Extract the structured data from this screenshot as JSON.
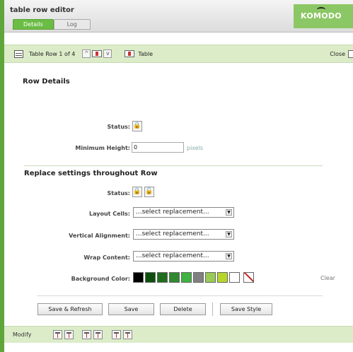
{
  "header": {
    "title": "table row editor",
    "tabs": [
      {
        "label": "Details"
      },
      {
        "label": "Log"
      }
    ],
    "brand": "KOMODO CMS"
  },
  "toolbar": {
    "row_label": "Table Row 1 of 4",
    "table_label": "Table",
    "close_label": "Close"
  },
  "row_details": {
    "title": "Row Details",
    "status_label": "Status:",
    "min_height_label": "Minimum Height:",
    "min_height_value": "0",
    "min_height_unit": "pixels"
  },
  "replace": {
    "title": "Replace settings throughout Row",
    "status_label": "Status:",
    "layout_cells_label": "Layout Cells:",
    "vertical_alignment_label": "Vertical Alignment:",
    "wrap_content_label": "Wrap Content:",
    "select_placeholder": "...select replacement...",
    "background_color_label": "Background Color:",
    "clear_label": "Clear",
    "swatches": [
      "#000000",
      "#0d4f0d",
      "#1f6e1f",
      "#2f8a2f",
      "#3fb33f",
      "#808080",
      "#99cc55",
      "#b7d62a",
      "#ffffff"
    ]
  },
  "actions": {
    "save_refresh": "Save & Refresh",
    "save": "Save",
    "delete": "Delete",
    "save_style": "Save Style"
  },
  "footer": {
    "label": "Modify"
  }
}
